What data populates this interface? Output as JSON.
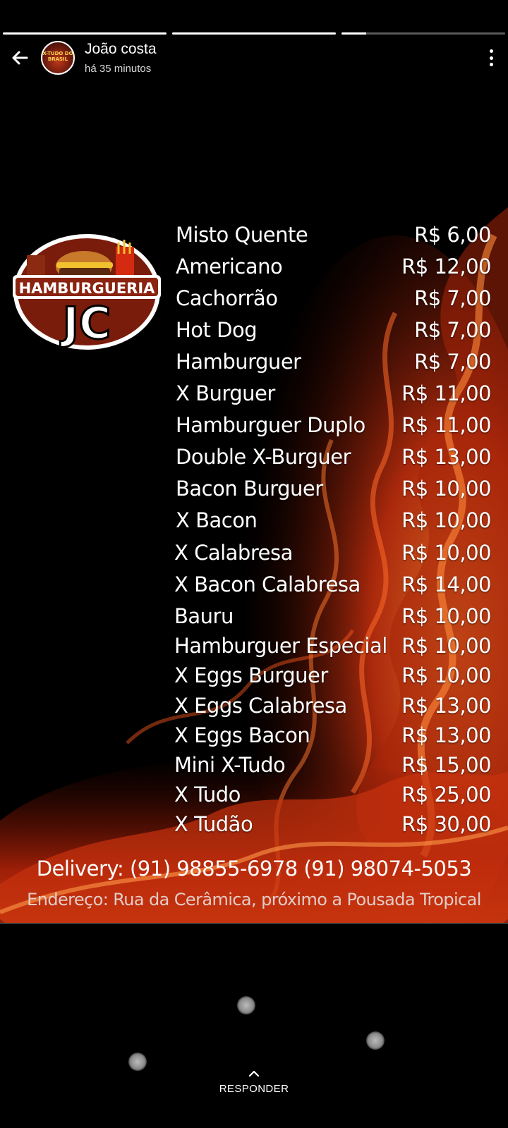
{
  "progress": {
    "segments": [
      1.0,
      1.0,
      0.15
    ]
  },
  "header": {
    "user_name": "João costa",
    "time_ago": "há 35 minutos",
    "avatar_text": "X-TUDO DO BRASIL"
  },
  "logo": {
    "line1": "HAMBURGUERIA",
    "line2": "JC"
  },
  "menu": {
    "items": [
      {
        "name": "Misto Quente",
        "price": "R$ 6,00"
      },
      {
        "name": "Americano",
        "price": "R$ 12,00"
      },
      {
        "name": "Cachorrão",
        "price": "R$ 7,00"
      },
      {
        "name": "Hot Dog",
        "price": "R$ 7,00"
      },
      {
        "name": "Hamburguer",
        "price": "R$ 7,00"
      },
      {
        "name": "X Burguer",
        "price": "R$ 11,00"
      },
      {
        "name": "Hamburguer Duplo",
        "price": "R$ 11,00"
      },
      {
        "name": "Double X-Burguer",
        "price": "R$ 13,00"
      },
      {
        "name": "Bacon Burguer",
        "price": "R$ 10,00"
      },
      {
        "name": "X Bacon",
        "price": "R$ 10,00"
      },
      {
        "name": "X Calabresa",
        "price": "R$ 10,00"
      },
      {
        "name": "X Bacon Calabresa",
        "price": "R$ 14,00"
      },
      {
        "name": "Bauru",
        "price": "R$ 10,00"
      },
      {
        "name": "Hamburguer Especial",
        "price": "R$ 10,00"
      },
      {
        "name": "X Eggs Burguer",
        "price": "R$ 10,00"
      },
      {
        "name": "X Eggs Calabresa",
        "price": "R$ 13,00"
      },
      {
        "name": "X Eggs Bacon",
        "price": "R$ 13,00"
      },
      {
        "name": "Mini X-Tudo",
        "price": "R$ 15,00"
      },
      {
        "name": "X Tudo",
        "price": "R$ 25,00"
      },
      {
        "name": "X Tudão",
        "price": "R$ 30,00"
      }
    ],
    "delivery": "Delivery: (91) 98855-6978 (91) 98074-5053",
    "address": "Endereço: Rua da Cerâmica, próximo a Pousada Tropical"
  },
  "reply": {
    "label": "RESPONDER"
  },
  "colors": {
    "flame_dark": "#8a1a05",
    "flame_mid": "#e0401a",
    "flame_light": "#ff8a3a",
    "background": "#000000"
  }
}
